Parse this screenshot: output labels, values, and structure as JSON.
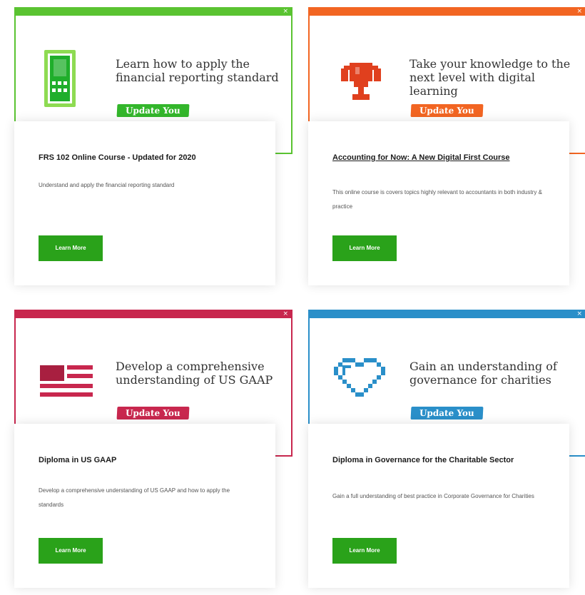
{
  "tiles": [
    {
      "color": "#5ac331",
      "icon": "calculator-icon",
      "headline": "Learn how to apply the financial reporting standard",
      "update_label": "Update You",
      "close": "×",
      "course_title": "FRS 102 Online Course - Updated for 2020",
      "description": "Understand and apply the financial reporting standard",
      "learn_more": "Learn More"
    },
    {
      "color": "#f26522",
      "icon": "trophy-icon",
      "headline": "Take your knowledge to the next level with digital learning",
      "update_label": "Update You",
      "close": "×",
      "course_title": "Accounting for Now: A New Digital First Course",
      "description": "This online course is covers topics highly relevant to accountants in both industry & practice",
      "learn_more": "Learn More"
    },
    {
      "color": "#c8274e",
      "icon": "us-flag-icon",
      "headline": "Develop a comprehensive understanding of US GAAP",
      "update_label": "Update You",
      "close": "×",
      "course_title": "Diploma in US GAAP",
      "description": "Develop a comprehensive understanding of US GAAP and how to apply the standards",
      "learn_more": "Learn More"
    },
    {
      "color": "#2a8fc9",
      "icon": "heart-icon",
      "headline": "Gain an understanding of governance for charities",
      "update_label": "Update You",
      "close": "×",
      "course_title": "Diploma in Governance for the Charitable Sector",
      "description": "Gain a full understanding of best practice in Corporate Governance for Charities",
      "learn_more": "Learn More"
    }
  ],
  "learn_more_color": "#2aa21a"
}
